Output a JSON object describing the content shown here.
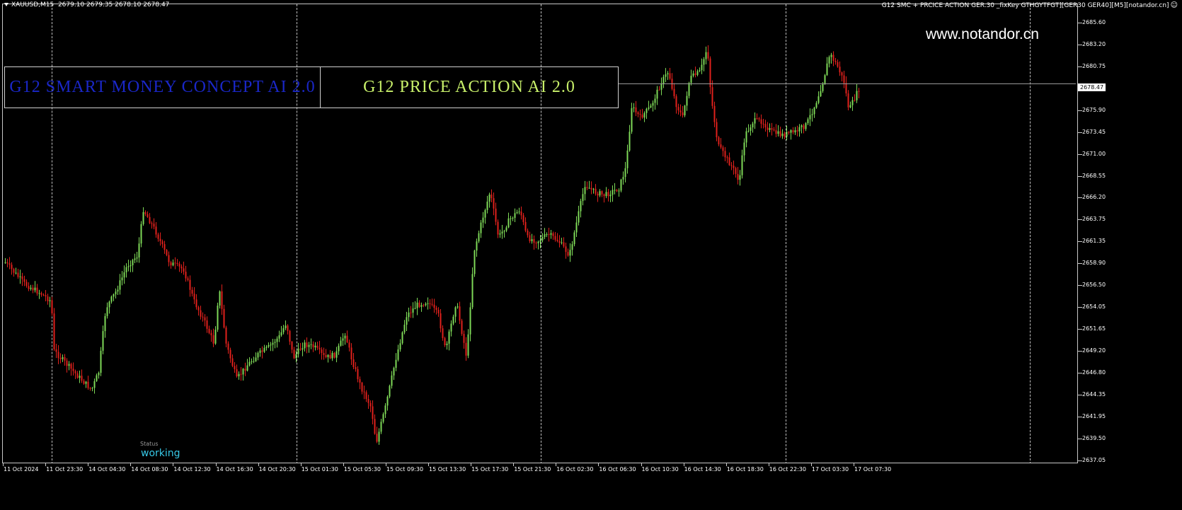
{
  "header": {
    "symbol": "XAUUSD,M15",
    "ohlc": "2679.10 2679.35 2678.10 2678.47",
    "indicator_info": "G12 SMC + PRCICE ACTION GER.30 _fixKey  GTHGYTFGT][GER30 GER40][M5][notandor.cn]",
    "indicator_icon": "smiley-icon"
  },
  "watermark": "www.notandor.cn",
  "banner": {
    "smc_title": "G12  SMART MONEY CONCEPT  AI 2.0",
    "pa_title": "G12  PRICE ACTION AI 2.0"
  },
  "status": {
    "label": "Status",
    "value": "working"
  },
  "price_axis": {
    "ticks": [
      "2685.60",
      "2683.20",
      "2680.75",
      "2678.30",
      "2675.90",
      "2673.45",
      "2671.00",
      "2668.55",
      "2666.20",
      "2663.75",
      "2661.35",
      "2658.90",
      "2656.50",
      "2654.05",
      "2651.65",
      "2649.20",
      "2646.80",
      "2644.35",
      "2641.95",
      "2639.50",
      "2637.05"
    ],
    "current_price": "2678.47"
  },
  "time_axis": {
    "labels": [
      "11 Oct 2024",
      "11 Oct 23:30",
      "14 Oct 04:30",
      "14 Oct 08:30",
      "14 Oct 12:30",
      "14 Oct 16:30",
      "14 Oct 20:30",
      "15 Oct 01:30",
      "15 Oct 05:30",
      "15 Oct 09:30",
      "15 Oct 13:30",
      "15 Oct 17:30",
      "15 Oct 21:30",
      "16 Oct 02:30",
      "16 Oct 06:30",
      "16 Oct 10:30",
      "16 Oct 14:30",
      "16 Oct 18:30",
      "16 Oct 22:30",
      "17 Oct 03:30",
      "17 Oct 07:30"
    ]
  },
  "colors": {
    "bull": "#7ed957",
    "bear": "#e0211c",
    "background": "#000000",
    "grid": "#c0c0c0"
  }
}
